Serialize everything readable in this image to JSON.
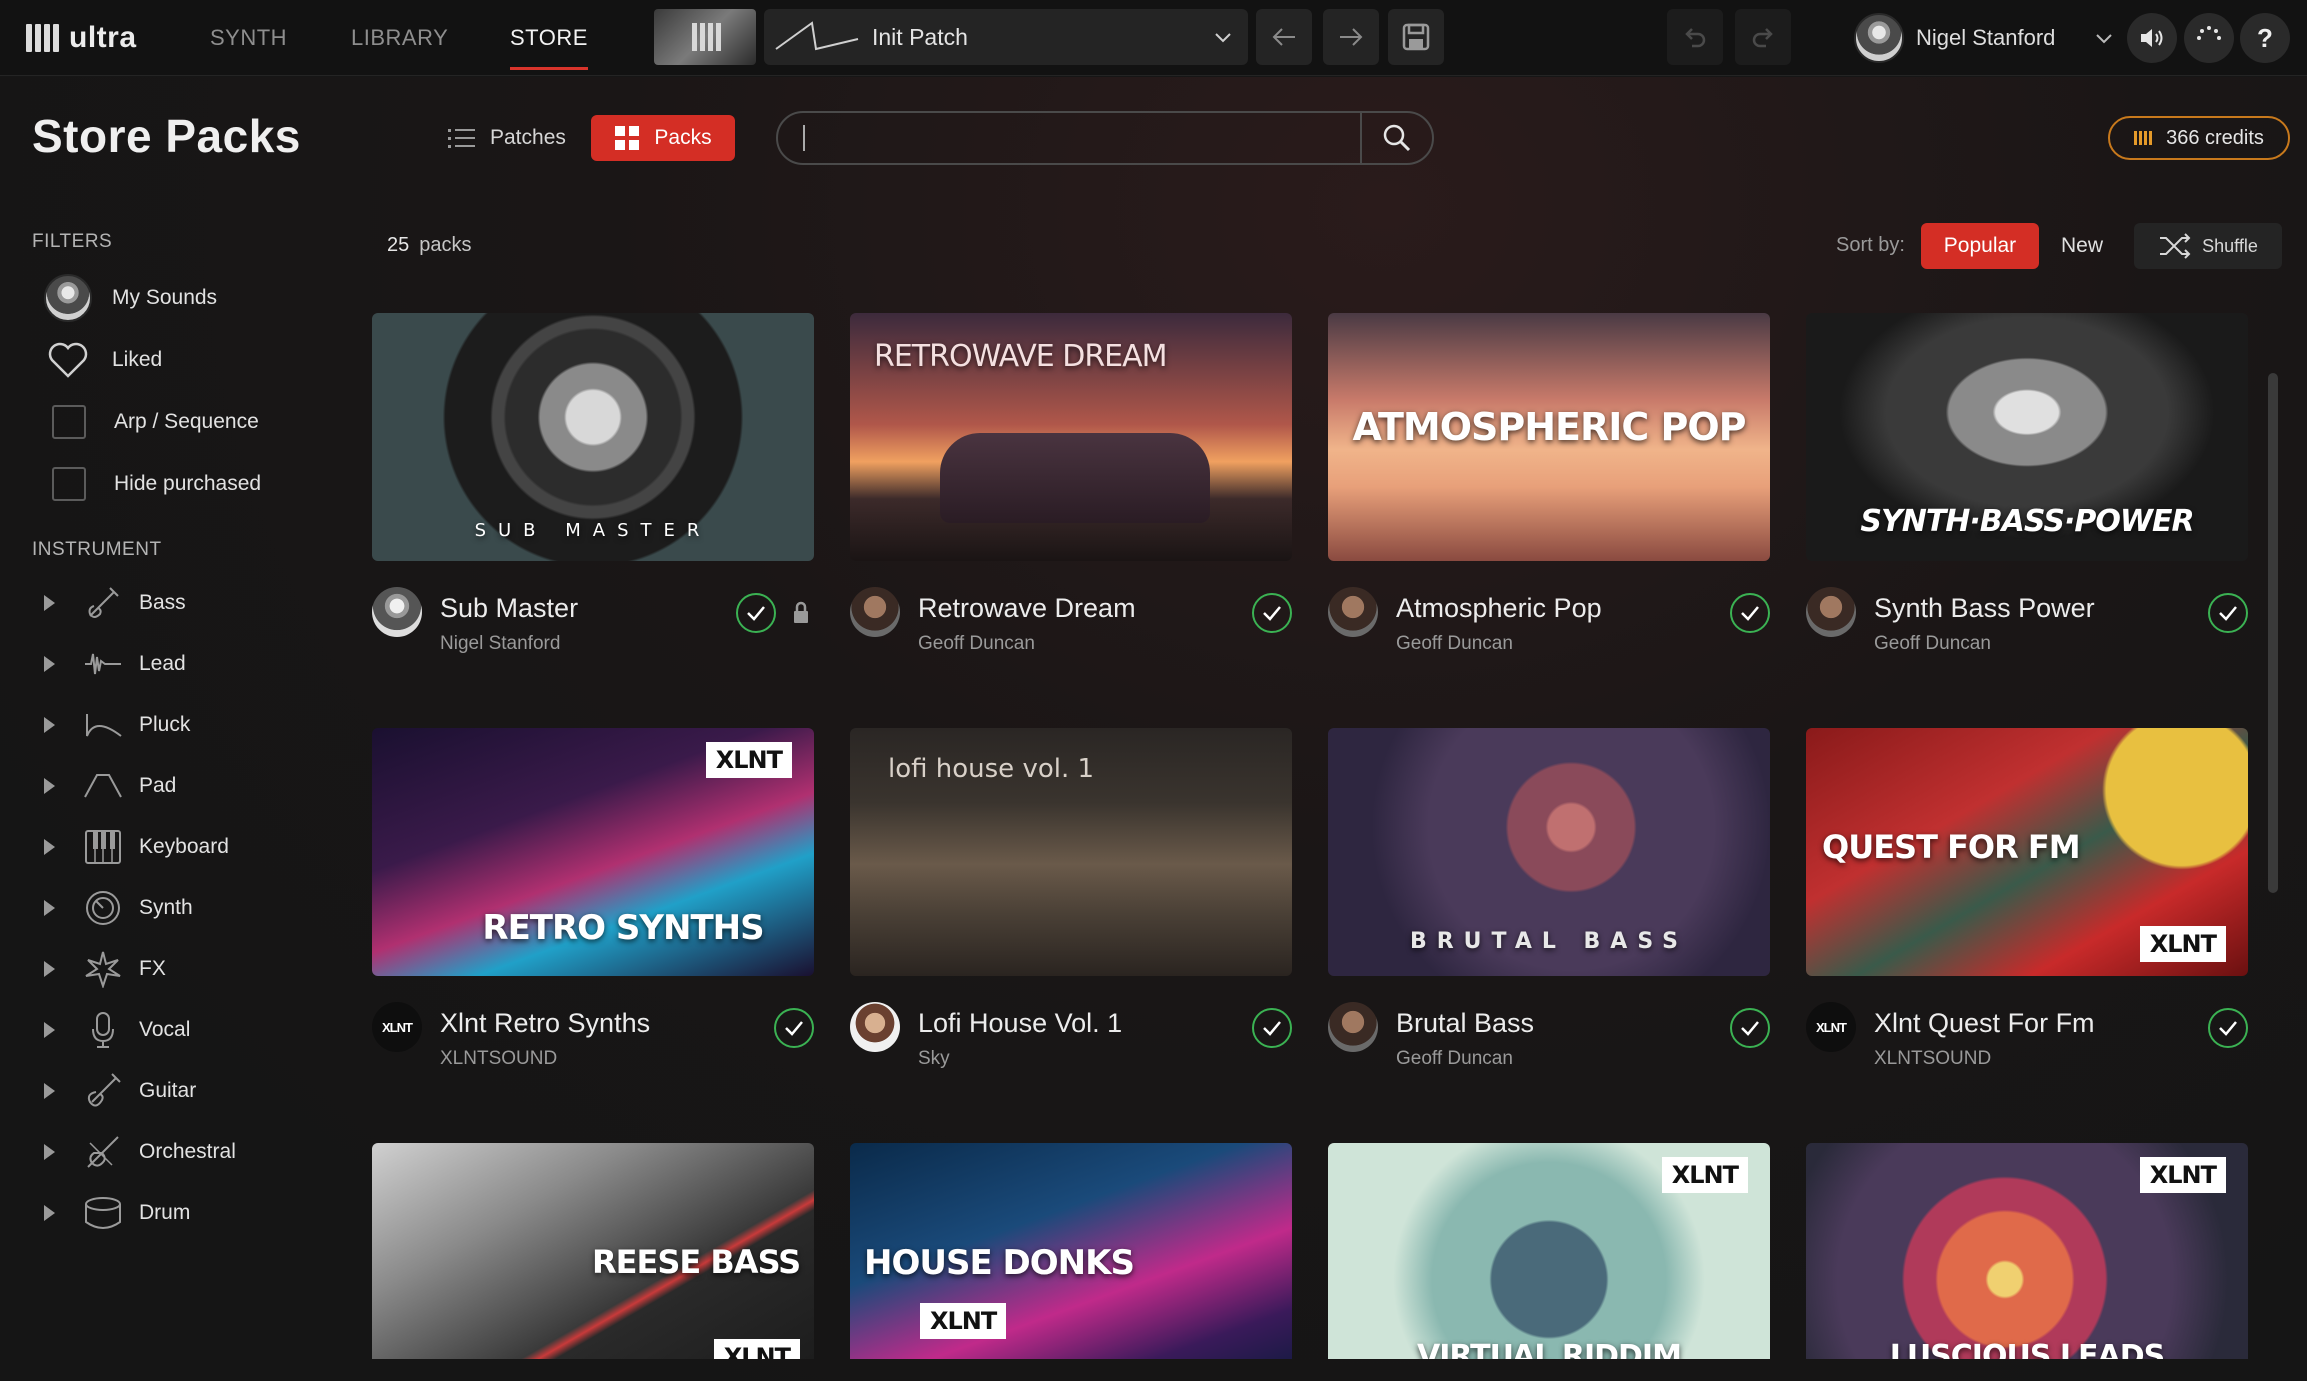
{
  "app": {
    "logo_text": "ultra",
    "nav": [
      {
        "label": "SYNTH",
        "active": false
      },
      {
        "label": "LIBRARY",
        "active": false
      },
      {
        "label": "STORE",
        "active": true
      }
    ],
    "patch": {
      "name": "Init Patch"
    },
    "user": {
      "name": "Nigel Stanford"
    },
    "accent_color": "#d42e25",
    "check_color": "#3bb253",
    "credits_color": "#c8791c"
  },
  "store": {
    "title": "Store Packs",
    "view_toggle": {
      "patches_label": "Patches",
      "packs_label": "Packs",
      "selected": "Packs"
    },
    "search": {
      "value": "",
      "placeholder": ""
    },
    "credits_label": "366 credits",
    "count_value": "25",
    "count_unit": "packs",
    "sort": {
      "label": "Sort by:",
      "options": [
        "Popular",
        "New"
      ],
      "selected": "Popular",
      "shuffle_label": "Shuffle"
    }
  },
  "sidebar": {
    "filters_heading": "FILTERS",
    "filters": [
      {
        "label": "My Sounds",
        "icon": "user-avatar"
      },
      {
        "label": "Liked",
        "icon": "heart-icon"
      },
      {
        "label": "Arp / Sequence",
        "icon": "checkbox",
        "checked": false
      },
      {
        "label": "Hide purchased",
        "icon": "checkbox",
        "checked": false
      }
    ],
    "instrument_heading": "INSTRUMENT",
    "instruments": [
      {
        "label": "Bass",
        "icon": "bass-guitar-icon"
      },
      {
        "label": "Lead",
        "icon": "lead-wave-icon"
      },
      {
        "label": "Pluck",
        "icon": "pluck-envelope-icon"
      },
      {
        "label": "Pad",
        "icon": "pad-envelope-icon"
      },
      {
        "label": "Keyboard",
        "icon": "keyboard-icon"
      },
      {
        "label": "Synth",
        "icon": "synth-knob-icon"
      },
      {
        "label": "FX",
        "icon": "fx-burst-icon"
      },
      {
        "label": "Vocal",
        "icon": "microphone-icon"
      },
      {
        "label": "Guitar",
        "icon": "guitar-icon"
      },
      {
        "label": "Orchestral",
        "icon": "violin-icon"
      },
      {
        "label": "Drum",
        "icon": "drum-icon"
      }
    ]
  },
  "packs": [
    {
      "name": "Sub Master",
      "author": "Nigel Stanford",
      "cover_text": "SUB   MASTER",
      "purchased": true,
      "locked": true,
      "xlnt": false
    },
    {
      "name": "Retrowave Dream",
      "author": "Geoff Duncan",
      "cover_text": "RETROWAVE DREAM",
      "purchased": true,
      "locked": false,
      "xlnt": false
    },
    {
      "name": "Atmospheric Pop",
      "author": "Geoff Duncan",
      "cover_text": "ATMOSPHERIC POP",
      "purchased": true,
      "locked": false,
      "xlnt": false
    },
    {
      "name": "Synth Bass Power",
      "author": "Geoff Duncan",
      "cover_text": "SYNTH·BASS·POWER",
      "purchased": true,
      "locked": false,
      "xlnt": false
    },
    {
      "name": "Xlnt Retro Synths",
      "author": "XLNTSOUND",
      "cover_text": "RETRO SYNTHS",
      "purchased": true,
      "locked": false,
      "xlnt": true
    },
    {
      "name": "Lofi House Vol. 1",
      "author": "Sky",
      "cover_text": "lofi house vol. 1",
      "purchased": true,
      "locked": false,
      "xlnt": false
    },
    {
      "name": "Brutal Bass",
      "author": "Geoff Duncan",
      "cover_text": "BRUTAL   BASS",
      "purchased": true,
      "locked": false,
      "xlnt": false
    },
    {
      "name": "Xlnt Quest For Fm",
      "author": "XLNTSOUND",
      "cover_text": "QUEST FOR FM",
      "purchased": true,
      "locked": false,
      "xlnt": true
    },
    {
      "cover_text": "REESE BASS",
      "xlnt": true
    },
    {
      "cover_text": "HOUSE DONKS",
      "xlnt": true
    },
    {
      "cover_text": "VIRTUAL RIDDIM",
      "xlnt": true
    },
    {
      "cover_text": "LUSCIOUS LEADS",
      "xlnt": true
    }
  ],
  "badges": {
    "xlnt": "XLNT"
  }
}
